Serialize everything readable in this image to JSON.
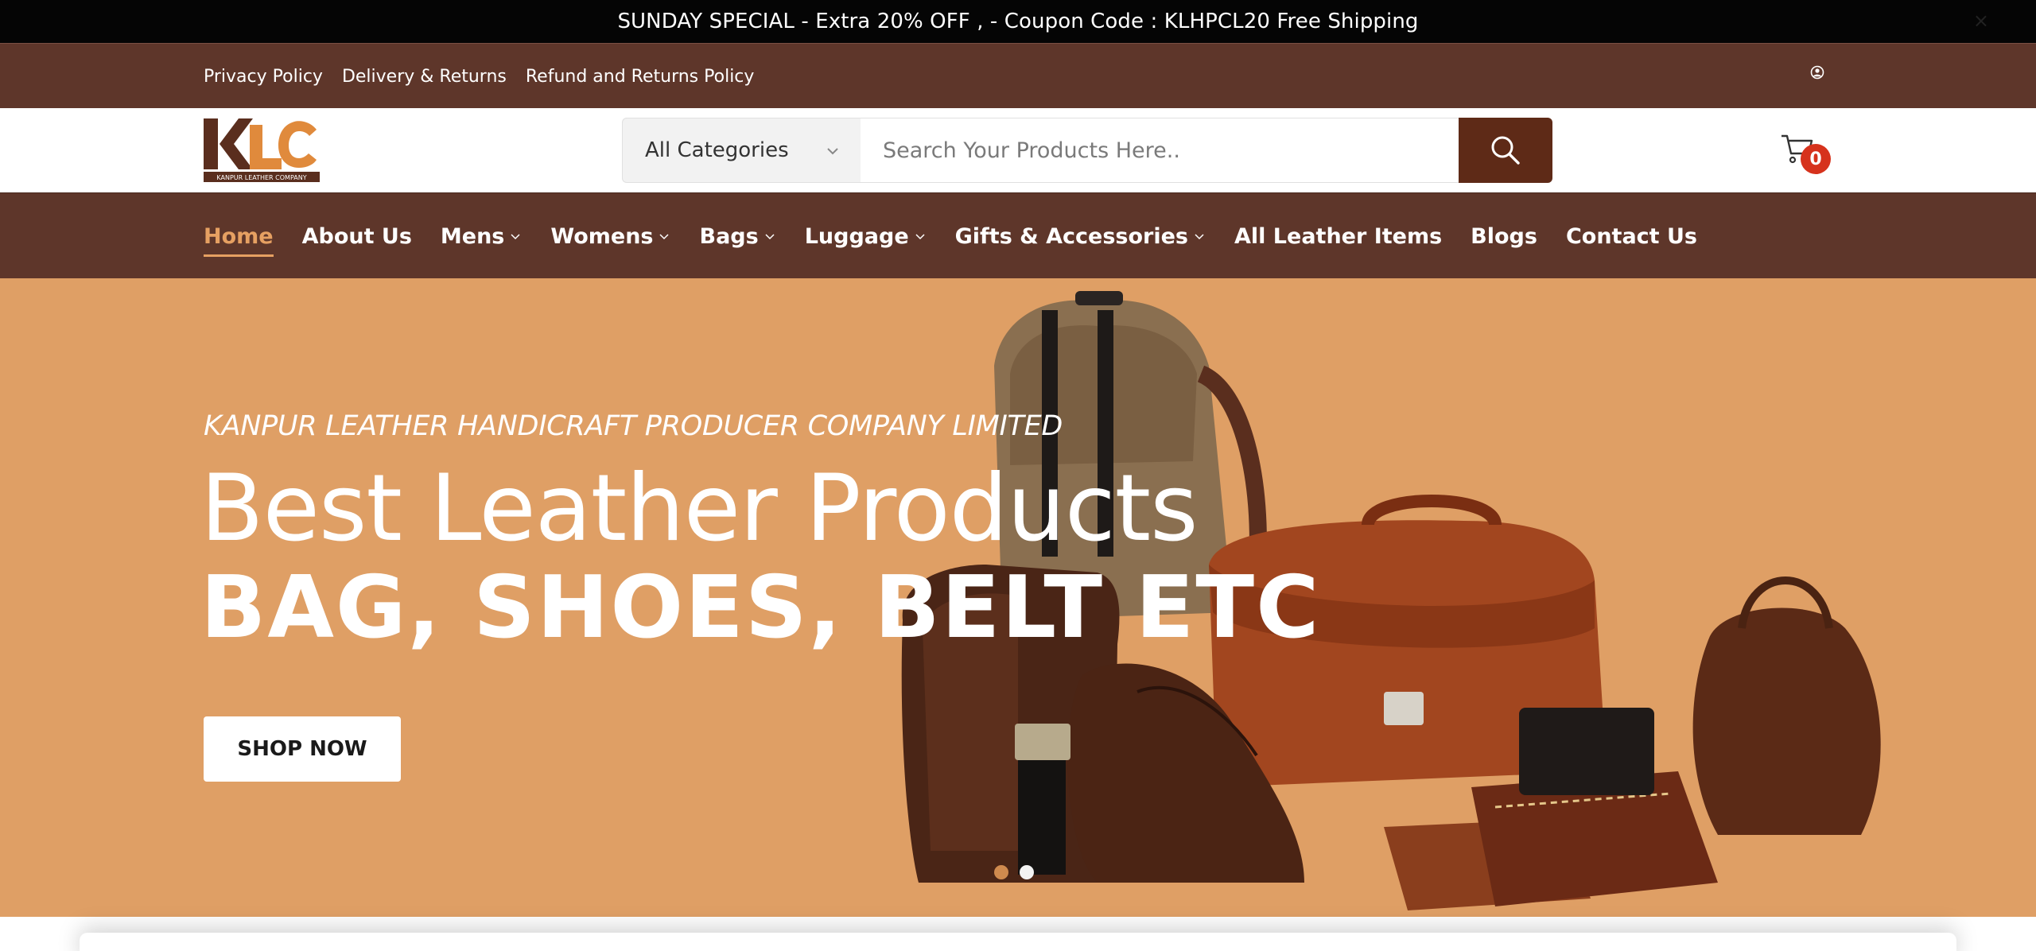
{
  "announcement": {
    "text": "SUNDAY SPECIAL - Extra 20% OFF , - Coupon Code : KLHPCL20 Free Shipping",
    "close_icon": "close-icon"
  },
  "top_links": [
    {
      "label": "Privacy Policy"
    },
    {
      "label": "Delivery & Returns"
    },
    {
      "label": "Refund and Returns Policy"
    }
  ],
  "account_icon": "user-circle-icon",
  "logo": {
    "letters": "KLC",
    "tagline": "KANPUR LEATHER COMPANY"
  },
  "search": {
    "category_label": "All Categories",
    "placeholder": "Search Your Products Here..",
    "value": ""
  },
  "cart": {
    "count": "0",
    "icon": "cart-icon"
  },
  "nav": {
    "items": [
      {
        "label": "Home",
        "dropdown": false,
        "active": true
      },
      {
        "label": "About Us",
        "dropdown": false
      },
      {
        "label": "Mens",
        "dropdown": true
      },
      {
        "label": "Womens",
        "dropdown": true
      },
      {
        "label": "Bags",
        "dropdown": true
      },
      {
        "label": "Luggage",
        "dropdown": true
      },
      {
        "label": "Gifts & Accessories",
        "dropdown": true
      },
      {
        "label": "All Leather Items",
        "dropdown": false
      },
      {
        "label": "Blogs",
        "dropdown": false
      },
      {
        "label": "Contact Us",
        "dropdown": false
      }
    ]
  },
  "hero": {
    "kicker": "KANPUR LEATHER HANDICRAFT PRODUCER COMPANY LIMITED",
    "title": "Best Leather Products",
    "subtitle": "BAG, SHOES, BELT ETC",
    "cta": "SHOP NOW",
    "slide_count": 2,
    "active_slide": 2
  },
  "colors": {
    "brand_brown": "#5e362a",
    "search_button": "#5e2a17",
    "hero_bg": "#df9f65",
    "active_nav": "#e6a062",
    "badge": "#d6321c"
  }
}
